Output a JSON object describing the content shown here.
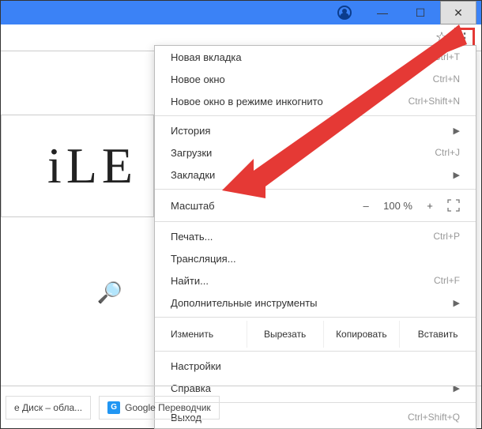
{
  "titlebar": {
    "minimize": "—",
    "maximize": "☐",
    "close": "✕"
  },
  "toolbar": {
    "star": "☆",
    "more": "⋮"
  },
  "doodle": {
    "text": "iLE"
  },
  "menu": {
    "new_tab": "Новая вкладка",
    "new_tab_sc": "Ctrl+T",
    "new_window": "Новое окно",
    "new_window_sc": "Ctrl+N",
    "incognito": "Новое окно в режиме инкогнито",
    "incognito_sc": "Ctrl+Shift+N",
    "history": "История",
    "downloads": "Загрузки",
    "downloads_sc": "Ctrl+J",
    "bookmarks": "Закладки",
    "zoom_label": "Масштаб",
    "zoom_minus": "–",
    "zoom_value": "100 %",
    "zoom_plus": "+",
    "print": "Печать...",
    "print_sc": "Ctrl+P",
    "cast": "Трансляция...",
    "find": "Найти...",
    "find_sc": "Ctrl+F",
    "more_tools": "Дополнительные инструменты",
    "edit_label": "Изменить",
    "cut": "Вырезать",
    "copy": "Копировать",
    "paste": "Вставить",
    "settings": "Настройки",
    "help": "Справка",
    "exit": "Выход",
    "exit_sc": "Ctrl+Shift+Q"
  },
  "taskbar": {
    "disk": "е Диск – обла...",
    "translate": "Google Переводчик"
  }
}
